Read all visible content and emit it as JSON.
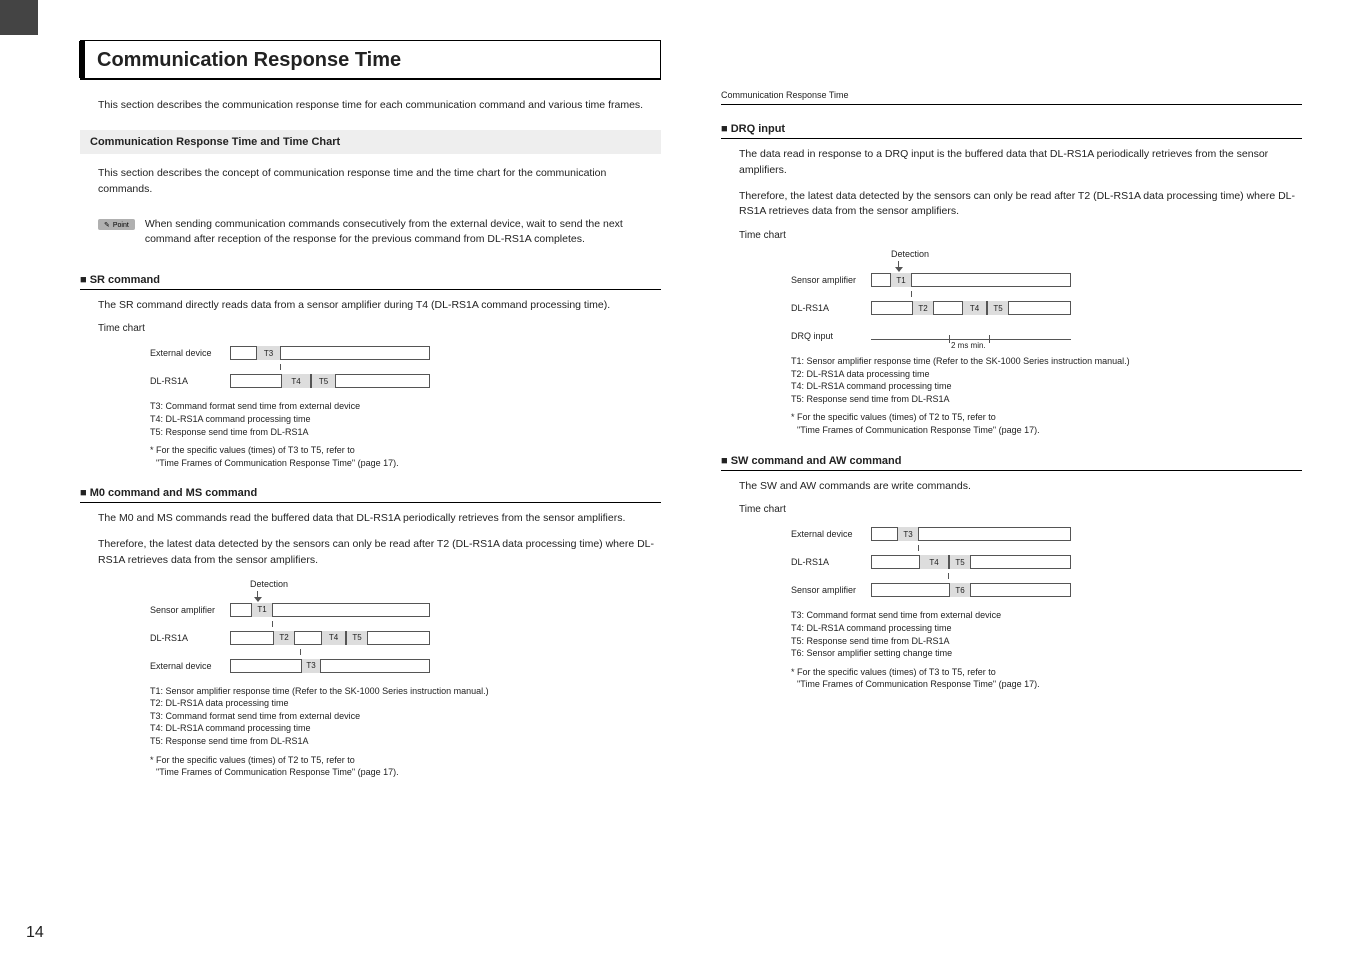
{
  "pageNumber": "14",
  "runningHead": "Communication Response Time",
  "chapterTitle": "Communication Response Time",
  "intro": "This section describes the communication response time for each communication command and various time frames.",
  "section1": {
    "heading": "Communication Response Time and Time Chart",
    "para": "This section describes the concept of communication response time and the time chart for the communication commands.",
    "pointLabel": "Point",
    "pointText": "When sending communication commands consecutively from the external device, wait to send the next command after reception of the response for the previous command from DL-RS1A completes."
  },
  "sr": {
    "heading": "■ SR command",
    "para": "The SR command directly reads data from a sensor amplifier during T4 (DL-RS1A command processing time).",
    "tc": "Time chart",
    "rows": {
      "r1": "External device",
      "r2": "DL-RS1A"
    },
    "seg": {
      "t3": "T3",
      "t4": "T4",
      "t5": "T5"
    },
    "legend": {
      "l1": "T3: Command format send time from external device",
      "l2": "T4: DL-RS1A command processing time",
      "l3": "T5: Response send time from DL-RS1A"
    },
    "foot1": "* For the specific values (times) of T3 to T5, refer to",
    "foot2": "\"Time Frames of Communication Response Time\" (page 17)."
  },
  "m0": {
    "heading": "■ M0 command and MS command",
    "para1": "The M0 and MS commands read the buffered data that DL-RS1A periodically retrieves from the sensor amplifiers.",
    "para2": "Therefore, the latest data detected by the sensors can only be read after T2 (DL-RS1A data processing time) where DL-RS1A retrieves data from the sensor amplifiers.",
    "detect": "Detection",
    "rows": {
      "r1": "Sensor amplifier",
      "r2": "DL-RS1A",
      "r3": "External device"
    },
    "seg": {
      "t1": "T1",
      "t2": "T2",
      "t3": "T3",
      "t4": "T4",
      "t5": "T5"
    },
    "legend": {
      "l1": "T1: Sensor amplifier response time (Refer to the SK-1000 Series instruction manual.)",
      "l2": "T2: DL-RS1A data processing time",
      "l3": "T3: Command format send time from external device",
      "l4": "T4: DL-RS1A command processing time",
      "l5": "T5: Response send time from DL-RS1A"
    },
    "foot1": "* For the specific values (times) of T2 to T5, refer to",
    "foot2": "\"Time Frames of Communication Response Time\" (page 17)."
  },
  "drq": {
    "heading": "■ DRQ input",
    "para1": "The data read in response to a DRQ input is the buffered data that DL-RS1A periodically retrieves from the sensor amplifiers.",
    "para2": "Therefore, the latest data detected by the sensors can only be read after T2 (DL-RS1A data processing time) where DL-RS1A retrieves data from the sensor amplifiers.",
    "tc": "Time chart",
    "detect": "Detection",
    "rows": {
      "r1": "Sensor amplifier",
      "r2": "DL-RS1A",
      "r3": "DRQ input"
    },
    "seg": {
      "t1": "T1",
      "t2": "T2",
      "t4": "T4",
      "t5": "T5",
      "min": "2 ms min."
    },
    "legend": {
      "l1": "T1: Sensor amplifier response time (Refer to the SK-1000 Series instruction manual.)",
      "l2": "T2: DL-RS1A data processing time",
      "l3": "T4: DL-RS1A command processing time",
      "l4": "T5: Response send time from DL-RS1A"
    },
    "foot1": "* For the specific values (times) of T2 to T5, refer to",
    "foot2": "\"Time Frames of Communication Response Time\" (page 17)."
  },
  "sw": {
    "heading": "■ SW command and AW command",
    "para": "The SW and AW commands are write commands.",
    "tc": "Time chart",
    "rows": {
      "r1": "External device",
      "r2": "DL-RS1A",
      "r3": "Sensor amplifier"
    },
    "seg": {
      "t3": "T3",
      "t4": "T4",
      "t5": "T5",
      "t6": "T6"
    },
    "legend": {
      "l1": "T3: Command format send time from external device",
      "l2": "T4: DL-RS1A command processing time",
      "l3": "T5: Response send time from DL-RS1A",
      "l4": "T6: Sensor amplifier setting change time"
    },
    "foot1": "* For the specific values (times) of T3 to T5, refer to",
    "foot2": "\"Time Frames of Communication Response Time\" (page 17)."
  }
}
